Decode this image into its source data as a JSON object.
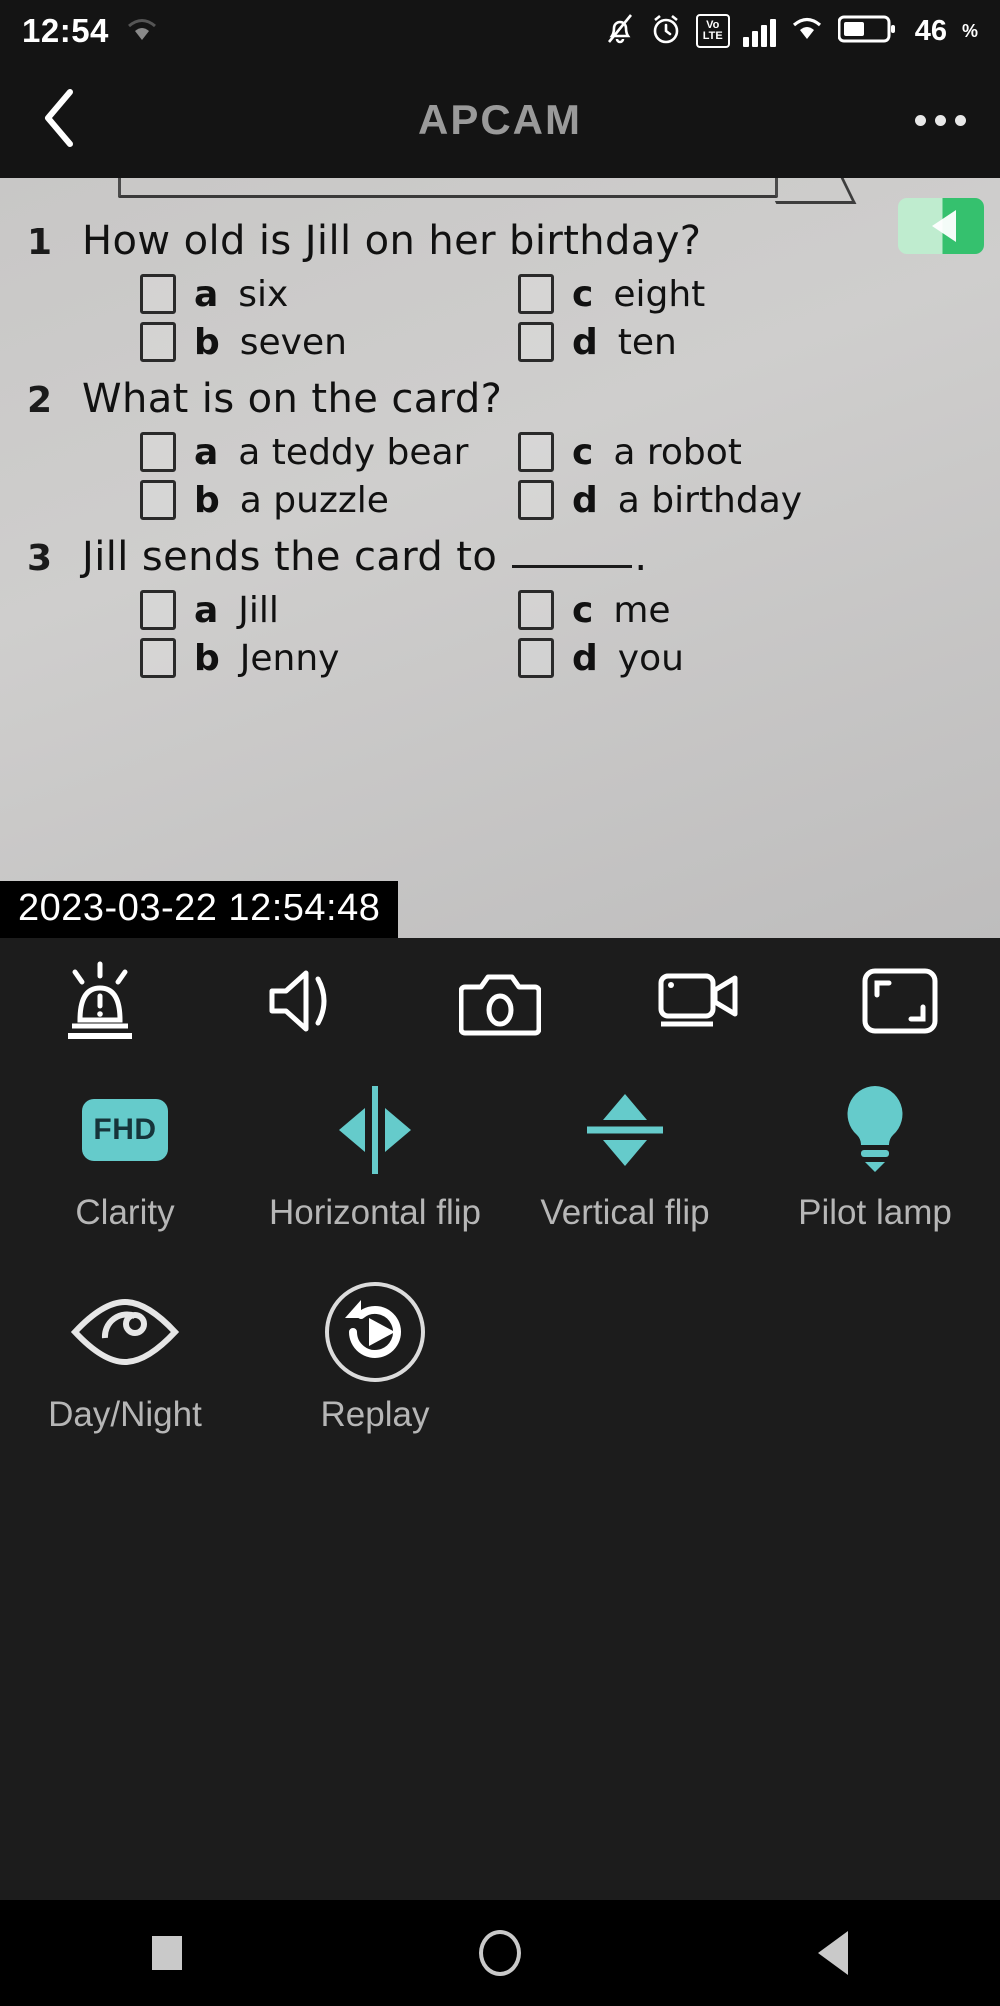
{
  "status_bar": {
    "time": "12:54",
    "battery_percent": "46",
    "percent_sign": "%",
    "volte_top": "Vo",
    "volte_bottom": "LTE",
    "icons": [
      "wifi-weak-icon",
      "bell-muted-icon",
      "alarm-clock-icon",
      "volte-icon",
      "signal-bars-icon",
      "wifi-icon",
      "battery-icon"
    ]
  },
  "title_bar": {
    "title": "APCAM",
    "back_icon": "back-chevron-icon",
    "menu_icon": "overflow-menu-icon"
  },
  "video": {
    "timestamp": "2023-03-22 12:54:48",
    "worksheet": {
      "questions": [
        {
          "number": "1",
          "text": "How old is Jill on her birthday?",
          "options_left": [
            {
              "letter": "a",
              "text": "six"
            },
            {
              "letter": "b",
              "text": "seven"
            }
          ],
          "options_right": [
            {
              "letter": "c",
              "text": "eight"
            },
            {
              "letter": "d",
              "text": "ten"
            }
          ]
        },
        {
          "number": "2",
          "text": "What is on the card?",
          "options_left": [
            {
              "letter": "a",
              "text": "a teddy bear"
            },
            {
              "letter": "b",
              "text": "a puzzle"
            }
          ],
          "options_right": [
            {
              "letter": "c",
              "text": "a robot"
            },
            {
              "letter": "d",
              "text": "a birthday"
            }
          ]
        },
        {
          "number": "3",
          "text_before_blank": "Jill sends the card to",
          "text_after_blank": ".",
          "options_left": [
            {
              "letter": "a",
              "text": "Jill"
            },
            {
              "letter": "b",
              "text": "Jenny"
            }
          ],
          "options_right": [
            {
              "letter": "c",
              "text": "me"
            },
            {
              "letter": "d",
              "text": "you"
            }
          ]
        }
      ]
    }
  },
  "controls": [
    {
      "name": "alarm-siren-icon"
    },
    {
      "name": "speaker-audio-icon"
    },
    {
      "name": "camera-snapshot-icon"
    },
    {
      "name": "video-record-icon"
    },
    {
      "name": "fullscreen-icon"
    }
  ],
  "features": [
    {
      "label": "Clarity",
      "icon": "fhd-badge-icon",
      "badge": "FHD",
      "active": true
    },
    {
      "label": "Horizontal flip",
      "icon": "horizontal-flip-icon",
      "active": true
    },
    {
      "label": "Vertical flip",
      "icon": "vertical-flip-icon",
      "active": true
    },
    {
      "label": "Pilot lamp",
      "icon": "light-bulb-icon",
      "active": true
    },
    {
      "label": "Day/Night",
      "icon": "eye-icon",
      "active": false
    },
    {
      "label": "Replay",
      "icon": "replay-icon",
      "active": false
    }
  ],
  "nav_bar": {
    "recents": "recents-square-icon",
    "home": "home-circle-icon",
    "back": "back-triangle-icon"
  },
  "colors": {
    "accent_teal": "#65CBCB",
    "panel_bg": "#1C1C1C",
    "header_bg": "#141414",
    "label_gray": "#B6B6B6",
    "sticker_green": "#35C16E"
  }
}
